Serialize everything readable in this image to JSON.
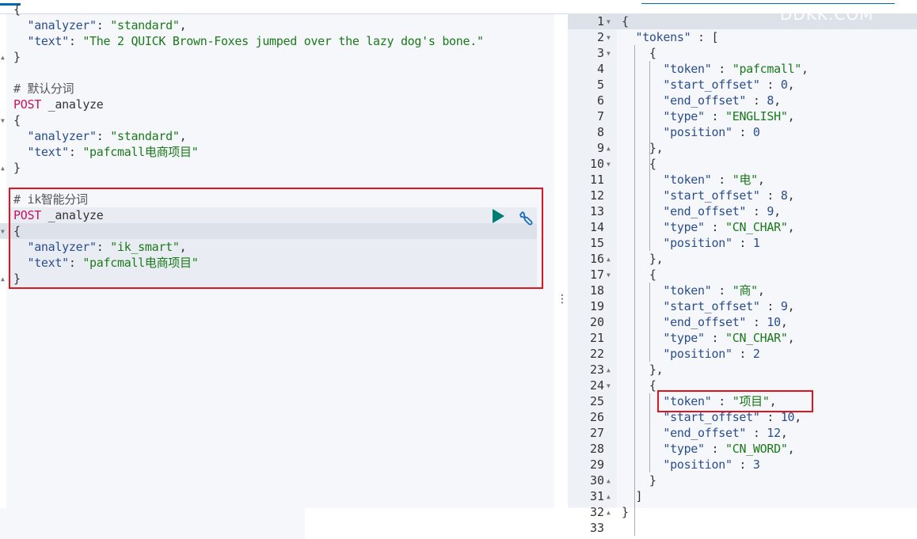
{
  "watermark": "DDKK.COM",
  "colors": {
    "key": "#2a4d8f",
    "string": "#1a7a1a",
    "method": "#c8105a",
    "highlight_box": "#e0141e",
    "run": "#017d73"
  },
  "request_editor": {
    "lines": [
      [
        [
          "p",
          "{"
        ]
      ],
      [
        [
          "k",
          "  \"analyzer\""
        ],
        [
          "p",
          ": "
        ],
        [
          "s",
          "\"standard\""
        ],
        [
          "p",
          ","
        ]
      ],
      [
        [
          "k",
          "  \"text\""
        ],
        [
          "p",
          ": "
        ],
        [
          "s",
          "\"The 2 QUICK Brown-Foxes jumped over the lazy dog's bone.\""
        ]
      ],
      [
        [
          "p",
          "}"
        ]
      ],
      [],
      [
        [
          "c",
          "# 默认分词"
        ]
      ],
      [
        [
          "m",
          "POST"
        ],
        [
          "p",
          " _analyze"
        ]
      ],
      [
        [
          "p",
          "{"
        ]
      ],
      [
        [
          "k",
          "  \"analyzer\""
        ],
        [
          "p",
          ": "
        ],
        [
          "s",
          "\"standard\""
        ],
        [
          "p",
          ","
        ]
      ],
      [
        [
          "k",
          "  \"text\""
        ],
        [
          "p",
          ": "
        ],
        [
          "s",
          "\"pafcmall电商项目\""
        ]
      ],
      [
        [
          "p",
          "}"
        ]
      ],
      [],
      [
        [
          "c",
          "# ik智能分词"
        ]
      ],
      [
        [
          "m",
          "POST"
        ],
        [
          "p",
          " _analyze"
        ]
      ],
      [
        [
          "p",
          "{"
        ]
      ],
      [
        [
          "k",
          "  \"analyzer\""
        ],
        [
          "p",
          ": "
        ],
        [
          "s",
          "\"ik_smart\""
        ],
        [
          "p",
          ","
        ]
      ],
      [
        [
          "k",
          "  \"text\""
        ],
        [
          "p",
          ": "
        ],
        [
          "s",
          "\"pafcmall电商项目\""
        ]
      ],
      [
        [
          "p",
          "}"
        ]
      ]
    ],
    "run_icon": "play-icon",
    "settings_icon": "wrench-icon"
  },
  "response_viewer": {
    "lines": [
      [
        [
          "p",
          "{"
        ]
      ],
      [
        [
          "k",
          "  \"tokens\""
        ],
        [
          "p",
          " : ["
        ]
      ],
      [
        [
          "p",
          "    {"
        ]
      ],
      [
        [
          "k",
          "      \"token\""
        ],
        [
          "p",
          " : "
        ],
        [
          "s",
          "\"pafcmall\""
        ],
        [
          "p",
          ","
        ]
      ],
      [
        [
          "k",
          "      \"start_offset\""
        ],
        [
          "p",
          " : "
        ],
        [
          "n",
          "0"
        ],
        [
          "p",
          ","
        ]
      ],
      [
        [
          "k",
          "      \"end_offset\""
        ],
        [
          "p",
          " : "
        ],
        [
          "n",
          "8"
        ],
        [
          "p",
          ","
        ]
      ],
      [
        [
          "k",
          "      \"type\""
        ],
        [
          "p",
          " : "
        ],
        [
          "s",
          "\"ENGLISH\""
        ],
        [
          "p",
          ","
        ]
      ],
      [
        [
          "k",
          "      \"position\""
        ],
        [
          "p",
          " : "
        ],
        [
          "n",
          "0"
        ]
      ],
      [
        [
          "p",
          "    },"
        ]
      ],
      [
        [
          "p",
          "    {"
        ]
      ],
      [
        [
          "k",
          "      \"token\""
        ],
        [
          "p",
          " : "
        ],
        [
          "s",
          "\"电\""
        ],
        [
          "p",
          ","
        ]
      ],
      [
        [
          "k",
          "      \"start_offset\""
        ],
        [
          "p",
          " : "
        ],
        [
          "n",
          "8"
        ],
        [
          "p",
          ","
        ]
      ],
      [
        [
          "k",
          "      \"end_offset\""
        ],
        [
          "p",
          " : "
        ],
        [
          "n",
          "9"
        ],
        [
          "p",
          ","
        ]
      ],
      [
        [
          "k",
          "      \"type\""
        ],
        [
          "p",
          " : "
        ],
        [
          "s",
          "\"CN_CHAR\""
        ],
        [
          "p",
          ","
        ]
      ],
      [
        [
          "k",
          "      \"position\""
        ],
        [
          "p",
          " : "
        ],
        [
          "n",
          "1"
        ]
      ],
      [
        [
          "p",
          "    },"
        ]
      ],
      [
        [
          "p",
          "    {"
        ]
      ],
      [
        [
          "k",
          "      \"token\""
        ],
        [
          "p",
          " : "
        ],
        [
          "s",
          "\"商\""
        ],
        [
          "p",
          ","
        ]
      ],
      [
        [
          "k",
          "      \"start_offset\""
        ],
        [
          "p",
          " : "
        ],
        [
          "n",
          "9"
        ],
        [
          "p",
          ","
        ]
      ],
      [
        [
          "k",
          "      \"end_offset\""
        ],
        [
          "p",
          " : "
        ],
        [
          "n",
          "10"
        ],
        [
          "p",
          ","
        ]
      ],
      [
        [
          "k",
          "      \"type\""
        ],
        [
          "p",
          " : "
        ],
        [
          "s",
          "\"CN_CHAR\""
        ],
        [
          "p",
          ","
        ]
      ],
      [
        [
          "k",
          "      \"position\""
        ],
        [
          "p",
          " : "
        ],
        [
          "n",
          "2"
        ]
      ],
      [
        [
          "p",
          "    },"
        ]
      ],
      [
        [
          "p",
          "    {"
        ]
      ],
      [
        [
          "k",
          "      \"token\""
        ],
        [
          "p",
          " : "
        ],
        [
          "s",
          "\"项目\""
        ],
        [
          "p",
          ","
        ]
      ],
      [
        [
          "k",
          "      \"start_offset\""
        ],
        [
          "p",
          " : "
        ],
        [
          "n",
          "10"
        ],
        [
          "p",
          ","
        ]
      ],
      [
        [
          "k",
          "      \"end_offset\""
        ],
        [
          "p",
          " : "
        ],
        [
          "n",
          "12"
        ],
        [
          "p",
          ","
        ]
      ],
      [
        [
          "k",
          "      \"type\""
        ],
        [
          "p",
          " : "
        ],
        [
          "s",
          "\"CN_WORD\""
        ],
        [
          "p",
          ","
        ]
      ],
      [
        [
          "k",
          "      \"position\""
        ],
        [
          "p",
          " : "
        ],
        [
          "n",
          "3"
        ]
      ],
      [
        [
          "p",
          "    }"
        ]
      ],
      [
        [
          "p",
          "  ]"
        ]
      ],
      [
        [
          "p",
          "}"
        ]
      ],
      []
    ],
    "line_numbers": [
      "1",
      "2",
      "3",
      "4",
      "5",
      "6",
      "7",
      "8",
      "9",
      "10",
      "11",
      "12",
      "13",
      "14",
      "15",
      "16",
      "17",
      "18",
      "19",
      "20",
      "21",
      "22",
      "23",
      "24",
      "25",
      "26",
      "27",
      "28",
      "29",
      "30",
      "31",
      "32",
      "33"
    ],
    "fold_open": [
      1,
      2,
      3,
      10,
      17,
      24
    ],
    "fold_close": [
      9,
      16,
      23,
      30,
      31,
      32
    ]
  }
}
